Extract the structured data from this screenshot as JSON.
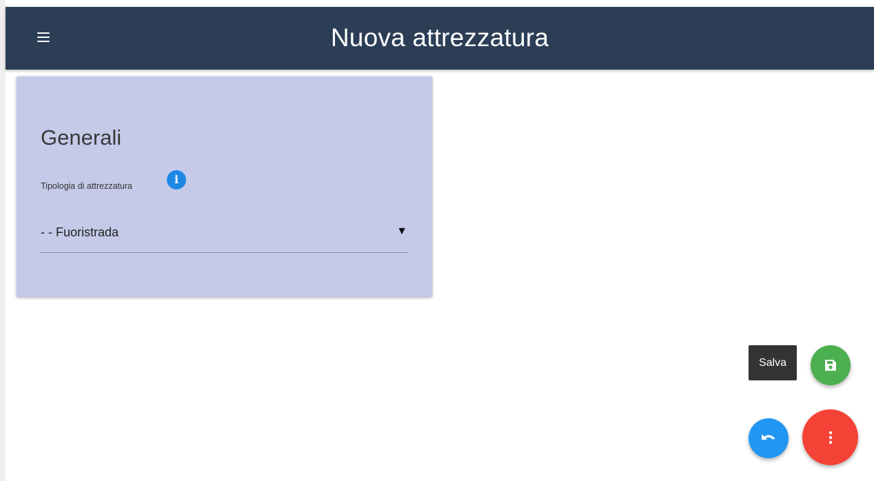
{
  "header": {
    "title": "Nuova attrezzatura",
    "menu_icon": "hamburger-menu-icon",
    "background_color": "#2c3e56"
  },
  "card": {
    "title": "Generali",
    "background_color": "#c5cae9",
    "field": {
      "label": "Tipologia di attrezzatura",
      "info_icon": "info-icon",
      "selected_value": "- - Fuoristrada",
      "arrow": "▼"
    }
  },
  "actions": {
    "save_tooltip": "Salva",
    "save_icon": "floppy-disk-icon",
    "save_color": "#4caf50",
    "undo_icon": "undo-icon",
    "undo_color": "#2196f3",
    "more_icon": "vertical-dots-icon",
    "more_color": "#f44336"
  }
}
